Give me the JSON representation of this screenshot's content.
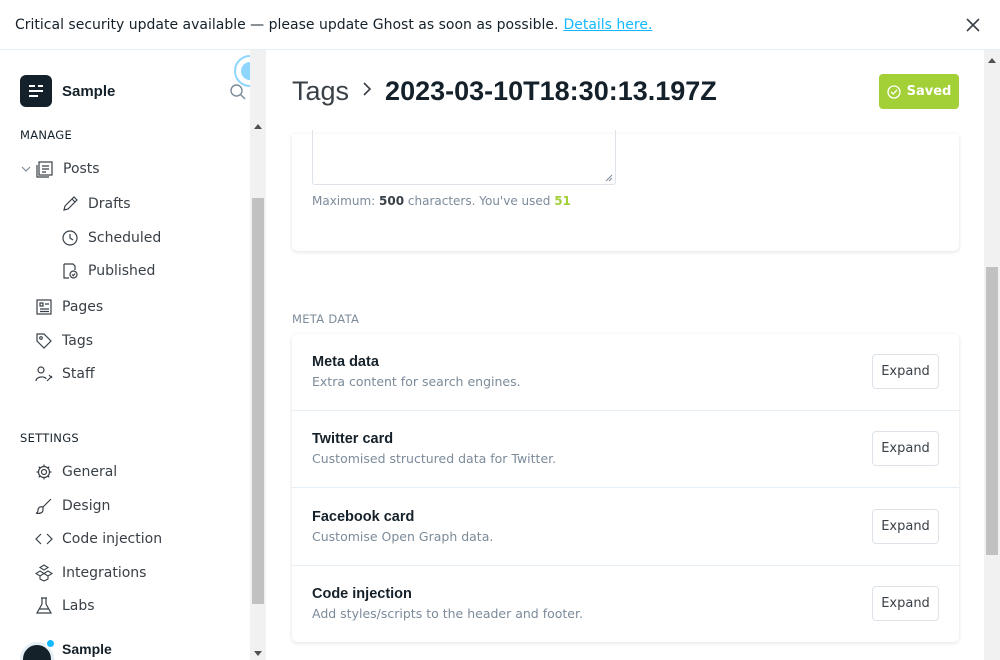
{
  "banner": {
    "message": "Critical security update available — please update Ghost as soon as possible.",
    "link": "Details here."
  },
  "sidebar": {
    "site_name": "Sample",
    "manage_title": "MANAGE",
    "posts": "Posts",
    "drafts": "Drafts",
    "scheduled": "Scheduled",
    "published": "Published",
    "pages": "Pages",
    "tags": "Tags",
    "staff": "Staff",
    "settings_title": "SETTINGS",
    "general": "General",
    "design": "Design",
    "code_injection": "Code injection",
    "integrations": "Integrations",
    "labs": "Labs",
    "user_name": "Sample"
  },
  "header": {
    "breadcrumb": "Tags",
    "title": "2023-03-10T18:30:13.197Z",
    "saved_label": "Saved"
  },
  "description": {
    "prefix": "Maximum:",
    "max": "500",
    "middle": "characters. You've used",
    "used": "51"
  },
  "meta": {
    "section_label": "META DATA",
    "rows": [
      {
        "title": "Meta data",
        "desc": "Extra content for search engines.",
        "button": "Expand"
      },
      {
        "title": "Twitter card",
        "desc": "Customised structured data for Twitter.",
        "button": "Expand"
      },
      {
        "title": "Facebook card",
        "desc": "Customise Open Graph data.",
        "button": "Expand"
      },
      {
        "title": "Code injection",
        "desc": "Add styles/scripts to the header and footer.",
        "button": "Expand"
      }
    ]
  },
  "colors": {
    "accent_green": "#a4d037",
    "link_blue": "#14b8ff",
    "dark": "#15212a"
  }
}
